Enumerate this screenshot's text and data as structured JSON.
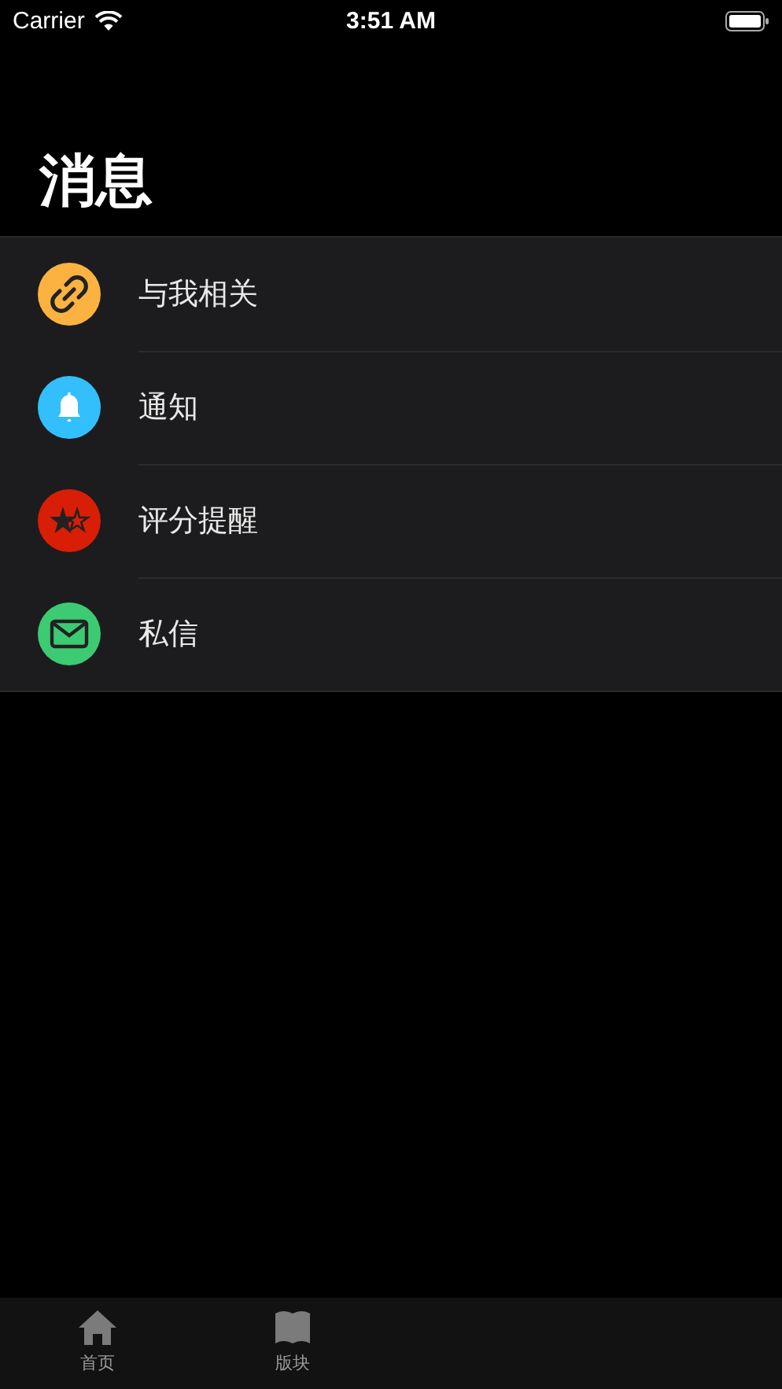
{
  "status_bar": {
    "carrier": "Carrier",
    "time": "3:51 AM"
  },
  "title": "消息",
  "items": [
    {
      "label": "与我相关",
      "kind": "link",
      "color": "#fbb240"
    },
    {
      "label": "通知",
      "kind": "bell",
      "color": "#33bffb"
    },
    {
      "label": "评分提醒",
      "kind": "stars",
      "color": "#d81e06"
    },
    {
      "label": "私信",
      "kind": "mail",
      "color": "#3ccb73"
    }
  ],
  "tab_bar": [
    {
      "label": "首页",
      "kind": "home"
    },
    {
      "label": "版块",
      "kind": "book"
    }
  ]
}
